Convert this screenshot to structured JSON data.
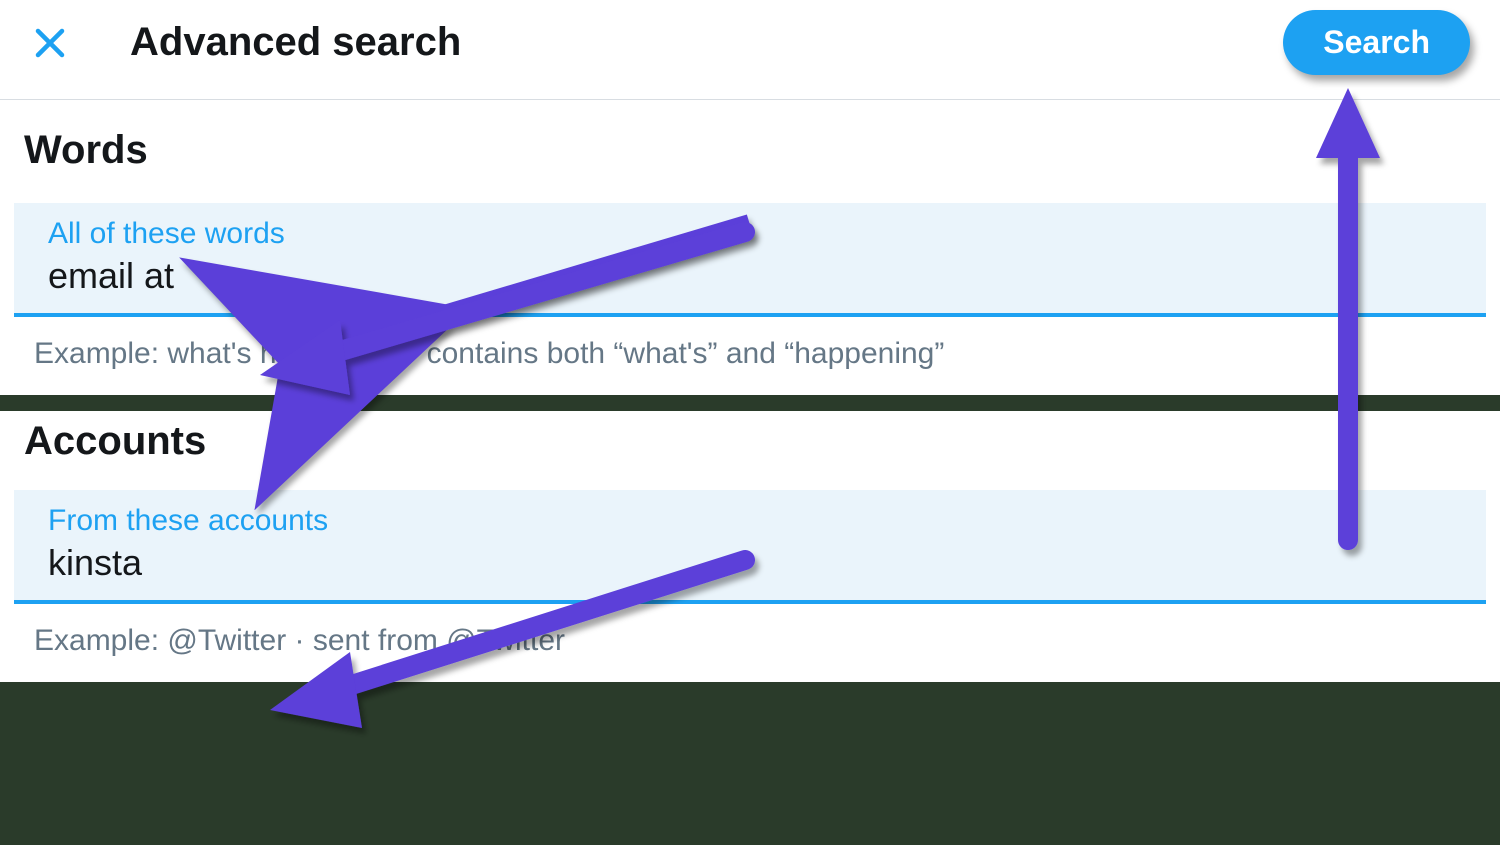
{
  "colors": {
    "accent": "#1da1f2",
    "annotation": "#5b3fd9",
    "text": "#14171a",
    "muted": "#657786",
    "field_bg": "#eaf4fb"
  },
  "header": {
    "title": "Advanced search",
    "close_icon": "close-icon",
    "search_button_label": "Search"
  },
  "sections": {
    "words": {
      "title": "Words",
      "field_label": "All of these words",
      "field_value": "email at",
      "example": "Example: what's happening · contains both “what's” and “happening”"
    },
    "accounts": {
      "title": "Accounts",
      "field_label": "From these accounts",
      "field_value": "kinsta",
      "example": "Example: @Twitter · sent from @Twitter"
    }
  }
}
